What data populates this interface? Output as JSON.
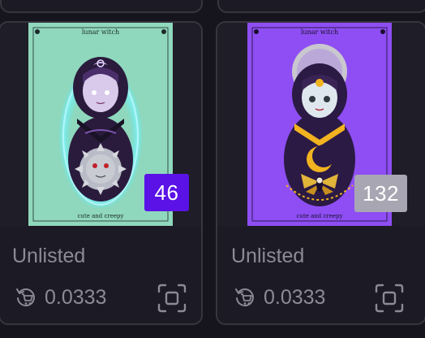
{
  "colors": {
    "background": "#16141d",
    "card": "#1c1a24",
    "border": "#38353f",
    "muted_text": "#8d8a97"
  },
  "cards": [
    {
      "art": {
        "title": "lunar witch",
        "caption": "cute and creepy",
        "background": "#8fd8bd",
        "glow": "#5ee7f0"
      },
      "badge": {
        "value": "46",
        "color": "#5a12e6"
      },
      "status": "Unlisted",
      "price": "0.0333",
      "price_icon": "cart-return-icon",
      "action_icon": "scan-frame-icon"
    },
    {
      "art": {
        "title": "lunar witch",
        "caption": "cute and creepy",
        "background": "#8e4ef3",
        "glow": "none"
      },
      "badge": {
        "value": "132",
        "color": "#a9a6b3"
      },
      "status": "Unlisted",
      "price": "0.0333",
      "price_icon": "cart-return-icon",
      "action_icon": "scan-frame-icon"
    }
  ]
}
